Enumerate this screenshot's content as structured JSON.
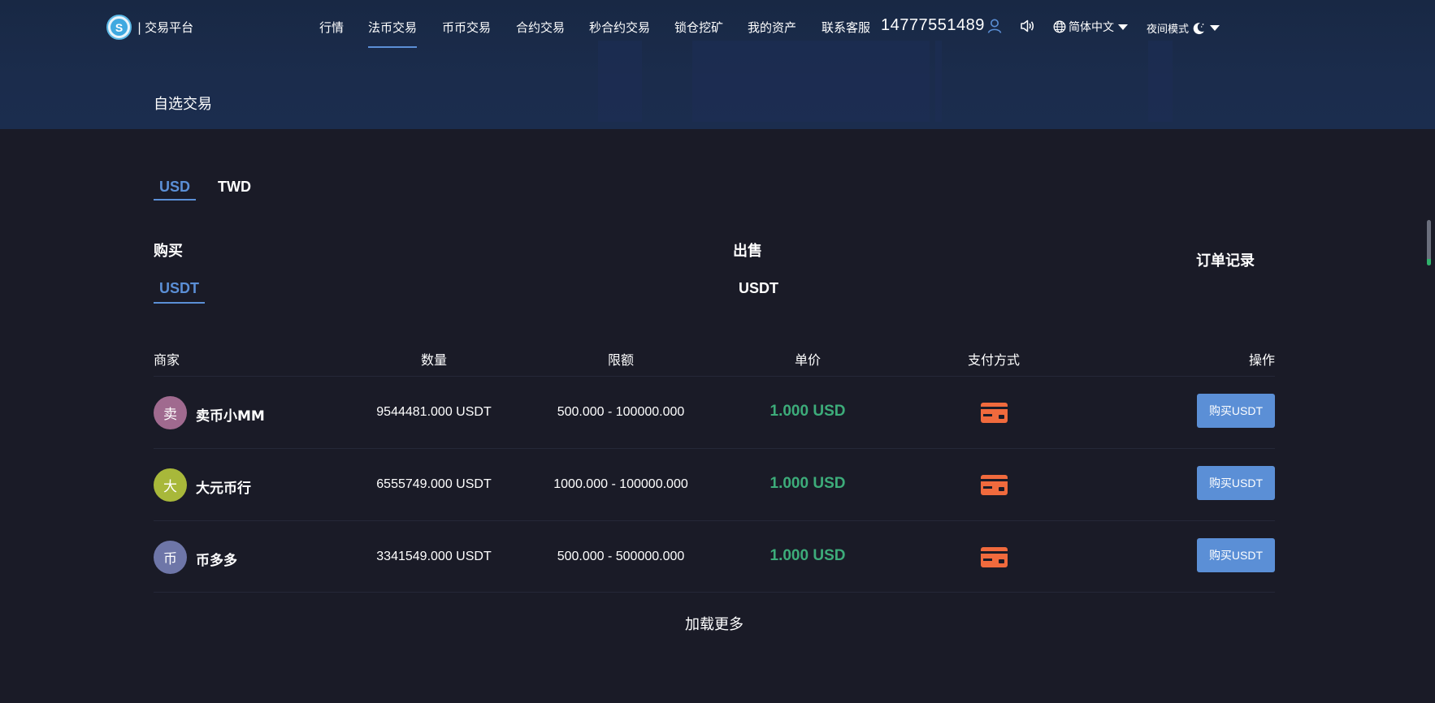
{
  "brand": {
    "logo_letter": "S",
    "separator": "|",
    "name": "交易平台"
  },
  "nav": {
    "items": [
      {
        "label": "行情"
      },
      {
        "label": "法币交易",
        "active": true
      },
      {
        "label": "币币交易"
      },
      {
        "label": "合约交易"
      },
      {
        "label": "秒合约交易"
      },
      {
        "label": "锁仓挖矿"
      },
      {
        "label": "我的资产"
      },
      {
        "label": "联系客服"
      }
    ],
    "phone": "14777551489",
    "language": "简体中文",
    "night_mode": "夜间模式"
  },
  "page": {
    "subtitle": "自选交易"
  },
  "currency_tabs": [
    {
      "label": "USD",
      "active": true
    },
    {
      "label": "TWD",
      "active": false
    }
  ],
  "buy_section": {
    "title": "购买",
    "coin": "USDT"
  },
  "sell_section": {
    "title": "出售",
    "coin": "USDT"
  },
  "order_record": "订单记录",
  "table": {
    "headers": [
      "商家",
      "数量",
      "限额",
      "单价",
      "支付方式",
      "操作"
    ],
    "rows": [
      {
        "avatar_char": "卖",
        "avatar_color": "#a06a8f",
        "merchant": "卖币小MM",
        "quantity": "9544481.000 USDT",
        "limit": "500.000 - 100000.000",
        "price": "1.000 USD",
        "payment_icon": "bank-card-icon",
        "action": "购买USDT"
      },
      {
        "avatar_char": "大",
        "avatar_color": "#a8b83a",
        "merchant": "大元币行",
        "quantity": "6555749.000 USDT",
        "limit": "1000.000 - 100000.000",
        "price": "1.000 USD",
        "payment_icon": "bank-card-icon",
        "action": "购买USDT"
      },
      {
        "avatar_char": "币",
        "avatar_color": "#6e76a8",
        "merchant": "币多多",
        "quantity": "3341549.000 USDT",
        "limit": "500.000 - 500000.000",
        "price": "1.000 USD",
        "payment_icon": "bank-card-icon",
        "action": "购买USDT"
      }
    ]
  },
  "load_more": "加载更多",
  "colors": {
    "accent": "#5b8fd6",
    "price": "#3dac7a",
    "payment_icon": "#f06a3d",
    "background": "#1a1b27",
    "header": "#1b2c4c"
  }
}
